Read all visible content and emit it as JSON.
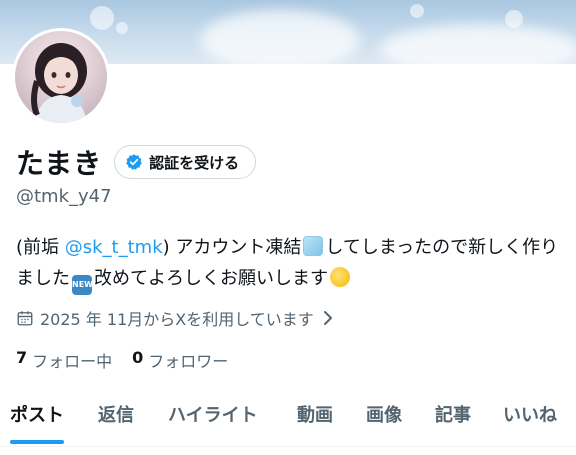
{
  "profile": {
    "display_name": "たまき",
    "verify_label": "認証を受ける",
    "handle": "@tmk_y47",
    "bio": {
      "prefix": "(前垢 ",
      "link": "@sk_t_tmk",
      "part2": ") アカウント凍結",
      "part3": "してしまったので新しく作りました",
      "part4": "改めてよろしくお願いします"
    },
    "joined": "2025 年 11月からXを利用しています",
    "following_count": "7",
    "following_label": "フォロー中",
    "followers_count": "0",
    "followers_label": "フォロワー"
  },
  "emoji": {
    "new_text": "NEW"
  },
  "tabs": [
    {
      "label": "ポスト",
      "active": true
    },
    {
      "label": "返信"
    },
    {
      "label": "ハイライト"
    },
    {
      "label": "動画"
    },
    {
      "label": "画像"
    },
    {
      "label": "記事"
    },
    {
      "label": "いいね"
    }
  ],
  "colors": {
    "accent": "#1d9bf0",
    "text_primary": "#0f1419",
    "text_secondary": "#536471"
  }
}
